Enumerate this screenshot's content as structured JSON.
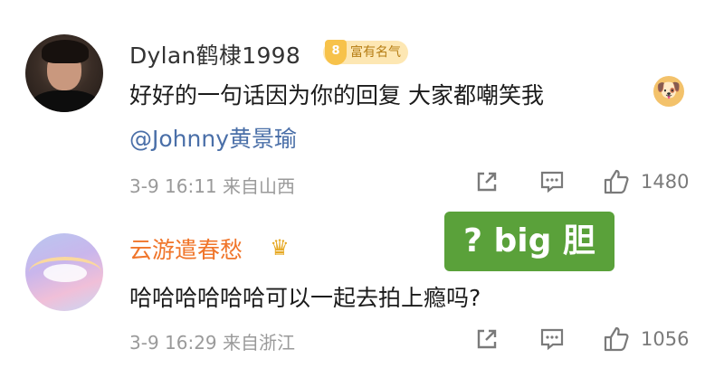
{
  "comments": [
    {
      "username": "Dylan鹤棣1998",
      "badge_level": "8",
      "badge_label": "富有名气",
      "text": "好好的一句话因为你的回复  大家都嘲笑我",
      "mention": "@Johnny黄景瑜",
      "meta": "3-9 16:11  来自山西",
      "likes": "1480",
      "emoji_icon": "doge-emoji-icon"
    },
    {
      "username": "云游遣春愁",
      "badge_icon": "crown-icon",
      "text": "哈哈哈哈哈哈可以一起去拍上瘾吗?",
      "meta": "3-9 16:29  来自浙江",
      "likes": "1056"
    }
  ],
  "overlay": {
    "text": "? big 胆",
    "color": "#5aa13a"
  },
  "colors": {
    "username_vip": "#f0752a",
    "mention": "#4a6fa8",
    "meta": "#9a9a9a"
  }
}
